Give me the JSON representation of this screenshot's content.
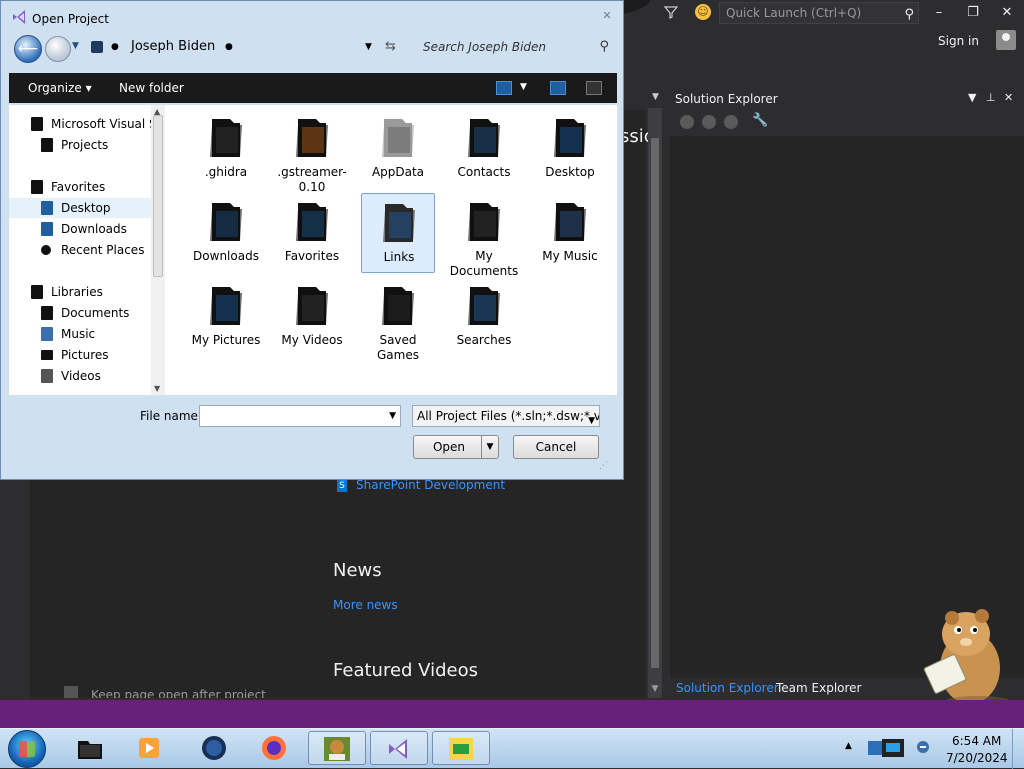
{
  "vs": {
    "quick_launch_placeholder": "Quick Launch (Ctrl+Q)",
    "minimize": "–",
    "restore": "❐",
    "close": "✕",
    "sign_in": "Sign in",
    "start": {
      "cut_text": "ssic",
      "sharepoint_link": "SharePoint Development",
      "news_heading": "News",
      "more_news": "More news",
      "featured_videos": "Featured Videos",
      "keep_open": "Keep page open after project"
    },
    "solution_explorer": {
      "title": "Solution Explorer",
      "tabs": [
        "Solution Explorer",
        "Team Explorer"
      ]
    },
    "colors": {
      "accent": "#68217a",
      "link": "#3794ff",
      "bg": "#2d2d30"
    }
  },
  "dialog": {
    "title": "Open Project",
    "address": {
      "path": "Joseph Biden"
    },
    "search_placeholder": "Search Joseph Biden",
    "toolbar": {
      "organize": "Organize",
      "new_folder": "New folder"
    },
    "nav": [
      {
        "label": "Microsoft Visual St",
        "indent": 0
      },
      {
        "label": "Projects",
        "indent": 1
      },
      {
        "label": "Favorites",
        "indent": 0
      },
      {
        "label": "Desktop",
        "indent": 1,
        "selected": true
      },
      {
        "label": "Downloads",
        "indent": 1
      },
      {
        "label": "Recent Places",
        "indent": 1
      },
      {
        "label": "Libraries",
        "indent": 0
      },
      {
        "label": "Documents",
        "indent": 1
      },
      {
        "label": "Music",
        "indent": 1
      },
      {
        "label": "Pictures",
        "indent": 1
      },
      {
        "label": "Videos",
        "indent": 1
      }
    ],
    "files": [
      {
        "label": ".ghidra",
        "icon": "folder-icon"
      },
      {
        "label": ".gstreamer-0.10",
        "icon": "vlc-folder-icon"
      },
      {
        "label": "AppData",
        "icon": "folder-icon"
      },
      {
        "label": "Contacts",
        "icon": "contacts-folder-icon"
      },
      {
        "label": "Desktop",
        "icon": "desktop-folder-icon"
      },
      {
        "label": "Downloads",
        "icon": "downloads-folder-icon"
      },
      {
        "label": "Favorites",
        "icon": "favorites-folder-icon"
      },
      {
        "label": "Links",
        "icon": "links-folder-icon",
        "selected": true
      },
      {
        "label": "My Documents",
        "icon": "documents-folder-icon"
      },
      {
        "label": "My Music",
        "icon": "music-folder-icon"
      },
      {
        "label": "My Pictures",
        "icon": "pictures-folder-icon"
      },
      {
        "label": "My Videos",
        "icon": "videos-folder-icon"
      },
      {
        "label": "Saved Games",
        "icon": "games-folder-icon"
      },
      {
        "label": "Searches",
        "icon": "searches-folder-icon"
      }
    ],
    "file_name_label": "File name:",
    "file_name_value": "",
    "file_type": "All Project Files (*.sln;*.dsw;*.vc",
    "open_label": "Open",
    "cancel_label": "Cancel"
  },
  "taskbar": {
    "time": "6:54 AM",
    "date": "7/20/2024"
  }
}
